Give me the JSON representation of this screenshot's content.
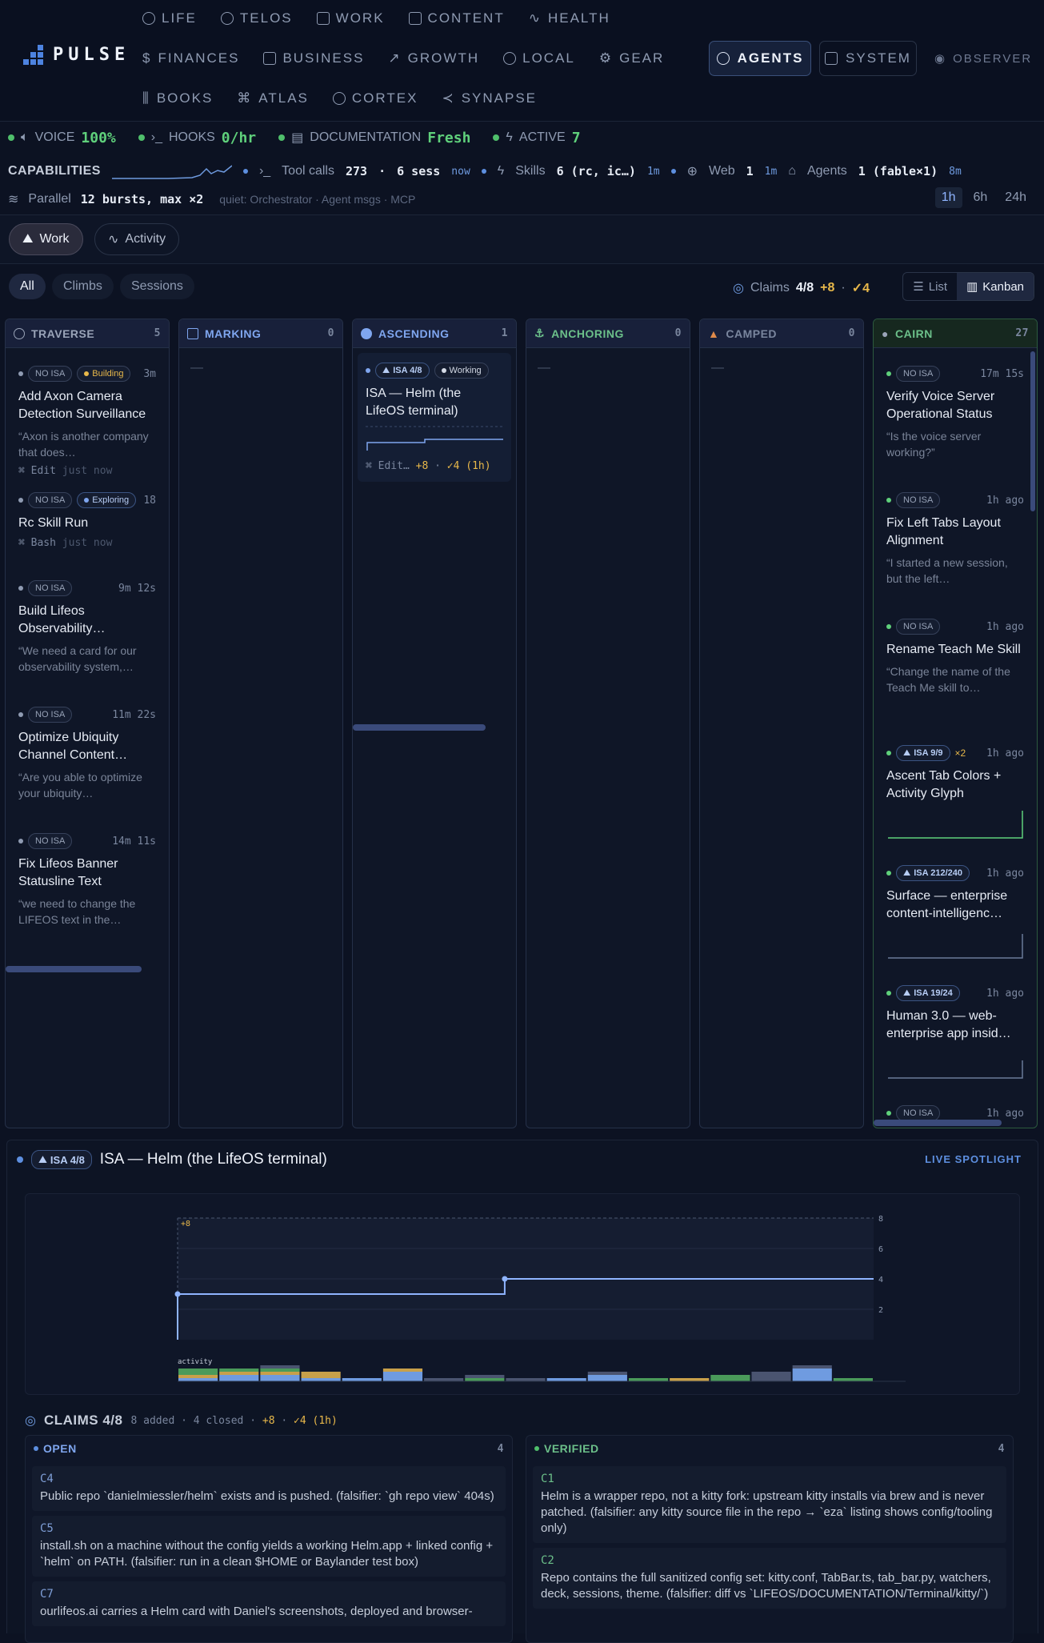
{
  "app": {
    "name": "PULSE"
  },
  "nav": {
    "row1": [
      {
        "label": "LIFE",
        "icon": "compass-icon"
      },
      {
        "label": "TELOS",
        "icon": "target-icon"
      },
      {
        "label": "WORK",
        "icon": "folder-icon"
      },
      {
        "label": "CONTENT",
        "icon": "file-stack-icon"
      },
      {
        "label": "HEALTH",
        "icon": "pulse-icon"
      }
    ],
    "row2": [
      {
        "label": "FINANCES",
        "icon": "dollar-icon"
      },
      {
        "label": "BUSINESS",
        "icon": "building-icon"
      },
      {
        "label": "GROWTH",
        "icon": "trend-up-icon"
      },
      {
        "label": "LOCAL",
        "icon": "map-pin-icon"
      },
      {
        "label": "GEAR",
        "icon": "gear-icon"
      }
    ],
    "row3": [
      {
        "label": "BOOKS",
        "icon": "books-icon"
      },
      {
        "label": "ATLAS",
        "icon": "network-icon"
      },
      {
        "label": "CORTEX",
        "icon": "brain-icon"
      },
      {
        "label": "SYNAPSE",
        "icon": "share-icon"
      }
    ],
    "agents": "AGENTS",
    "system": "SYSTEM",
    "observer": "OBSERVER"
  },
  "status": {
    "voice_label": "VOICE",
    "voice_value": "100%",
    "hooks_label": "HOOKS",
    "hooks_value": "0/hr",
    "docs_label": "DOCUMENTATION",
    "docs_value": "Fresh",
    "active_label": "ACTIVE",
    "active_value": "7"
  },
  "capabilities": {
    "label": "CAPABILITIES",
    "tool_calls_label": "Tool calls",
    "tool_calls_value": "273",
    "sep": "·",
    "sess_value": "6 sess",
    "tool_calls_time": "now",
    "skills_label": "Skills",
    "skills_value": "6 (rc, ic…)",
    "skills_time": "1m",
    "web_label": "Web",
    "web_value": "1",
    "web_time": "1m",
    "agents_label": "Agents",
    "agents_value": "1 (fable×1)",
    "agents_time": "8m"
  },
  "parallel": {
    "label": "Parallel",
    "value": "12 bursts, max ×2",
    "quiet": "quiet: Orchestrator · Agent msgs · MCP"
  },
  "time_range": {
    "options": [
      "1h",
      "6h",
      "24h"
    ],
    "selected": "1h"
  },
  "view_tabs": {
    "work": "Work",
    "activity": "Activity"
  },
  "filters": {
    "all": "All",
    "climbs": "Climbs",
    "sessions": "Sessions"
  },
  "claims_summary": {
    "label": "Claims",
    "value": "4/8",
    "added": "+8",
    "sep": "·",
    "closed": "✓4"
  },
  "view_switch": {
    "list": "List",
    "kanban": "Kanban"
  },
  "columns": [
    {
      "name": "TRAVERSE",
      "count": "5",
      "color": "#9aa4b8"
    },
    {
      "name": "MARKING",
      "count": "0",
      "color": "#7fa6ef"
    },
    {
      "name": "ASCENDING",
      "count": "1",
      "color": "#7fa6ef"
    },
    {
      "name": "ANCHORING",
      "count": "0",
      "color": "#6cc08a"
    },
    {
      "name": "CAMPED",
      "count": "0",
      "color": "#7a869e"
    },
    {
      "name": "CAIRN",
      "count": "27",
      "color": "#6cc08a"
    }
  ],
  "empty_mark": "—",
  "traverse_cards": [
    {
      "badge": "NO ISA",
      "state": "Building",
      "age": "3m",
      "title": "Add Axon Camera Detection Surveillance",
      "quote": "“Axon is another company that does…",
      "tool": "⌘ Edit",
      "tool_time": "just now"
    },
    {
      "badge": "NO ISA",
      "state": "Exploring",
      "age": "18",
      "title": "Rc Skill Run",
      "quote": "",
      "tool": "⌘ Bash",
      "tool_time": "just now"
    },
    {
      "badge": "NO ISA",
      "state": "",
      "age": "9m 12s",
      "title": "Build Lifeos Observability…",
      "quote": "“We need a card for our observability system,…",
      "tool": "",
      "tool_time": ""
    },
    {
      "badge": "NO ISA",
      "state": "",
      "age": "11m 22s",
      "title": "Optimize Ubiquity Channel Content…",
      "quote": "“Are you able to optimize your ubiquity…",
      "tool": "",
      "tool_time": ""
    },
    {
      "badge": "NO ISA",
      "state": "",
      "age": "14m 11s",
      "title": "Fix Lifeos Banner Statusline Text",
      "quote": "“we need to change the LIFEOS text in the…",
      "tool": "",
      "tool_time": ""
    }
  ],
  "ascending_card": {
    "badge": "ISA 4/8",
    "state": "Working",
    "title": "ISA — Helm (the LifeOS terminal)",
    "tool": "⌘ Edit…",
    "added": "+8",
    "closed": "✓4 (1h)"
  },
  "cairn_cards": [
    {
      "badge": "NO ISA",
      "extra": "",
      "age": "17m 15s",
      "title": "Verify Voice Server Operational Status",
      "quote": "“Is the voice server working?”"
    },
    {
      "badge": "NO ISA",
      "extra": "",
      "age": "1h ago",
      "title": "Fix Left Tabs Layout Alignment",
      "quote": "“I started a new session, but the left…"
    },
    {
      "badge": "NO ISA",
      "extra": "",
      "age": "1h ago",
      "title": "Rename Teach Me Skill",
      "quote": "“Change the name of the Teach Me skill to…"
    },
    {
      "badge": "ISA 9/9",
      "extra": "×2",
      "age": "1h ago",
      "title": "Ascent Tab Colors + Activity Glyph",
      "quote": ""
    },
    {
      "badge": "ISA 212/240",
      "extra": "",
      "age": "1h ago",
      "title": "Surface — enterprise content-intelligenc…",
      "quote": ""
    },
    {
      "badge": "ISA 19/24",
      "extra": "",
      "age": "1h ago",
      "title": "Human 3.0 — web-enterprise app insid…",
      "quote": ""
    },
    {
      "badge": "NO ISA",
      "extra": "",
      "age": "1h ago",
      "title": "",
      "quote": ""
    }
  ],
  "spotlight": {
    "badge": "ISA 4/8",
    "title": "ISA — Helm (the LifeOS terminal)",
    "live": "LIVE SPOTLIGHT"
  },
  "chart_data": {
    "type": "line",
    "title": "",
    "xlabel": "",
    "ylabel": "",
    "ylim": [
      0,
      8
    ],
    "yticks": [
      2,
      4,
      6,
      8
    ],
    "series": [
      {
        "name": "",
        "step": true,
        "x": [
          0,
          0.47,
          1
        ],
        "values": [
          3,
          4,
          4
        ]
      }
    ],
    "annotation": "+8",
    "activity_label": "activity",
    "activity": [
      [
        1,
        1,
        2,
        0
      ],
      [
        2,
        1,
        1,
        0
      ],
      [
        2,
        1,
        1,
        1
      ],
      [
        1,
        2,
        0,
        0
      ],
      [
        1,
        0,
        0,
        0
      ],
      [
        3,
        1,
        0,
        0
      ],
      [
        0,
        0,
        0,
        1
      ],
      [
        0,
        0,
        1,
        1
      ],
      [
        0,
        0,
        0,
        1
      ],
      [
        1,
        0,
        0,
        0
      ],
      [
        2,
        0,
        0,
        1
      ],
      [
        0,
        0,
        1,
        0
      ],
      [
        0,
        1,
        0,
        0
      ],
      [
        0,
        0,
        2,
        0
      ],
      [
        0,
        0,
        0,
        3
      ],
      [
        4,
        0,
        0,
        1
      ],
      [
        0,
        0,
        1,
        0
      ]
    ]
  },
  "claims": {
    "title": "CLAIMS 4/8",
    "meta": "8 added · 4 closed",
    "added": "+8",
    "closed": "✓4 (1h)",
    "open_label": "OPEN",
    "open_count": "4",
    "verified_label": "VERIFIED",
    "verified_count": "4",
    "open": [
      {
        "id": "C4",
        "text": "Public repo `danielmiessler/helm` exists and is pushed. (falsifier: `gh repo view` 404s)"
      },
      {
        "id": "C5",
        "text": "install.sh on a machine without the config yields a working Helm.app + linked config + `helm` on PATH. (falsifier: run in a clean $HOME or Baylander test box)"
      },
      {
        "id": "C7",
        "text": "ourlifeos.ai carries a Helm card with Daniel's screenshots, deployed and browser-"
      }
    ],
    "verified": [
      {
        "id": "C1",
        "text": "Helm is a wrapper repo, not a kitty fork: upstream kitty installs via brew and is never patched. (falsifier: any kitty source file in the repo → `eza` listing shows config/tooling only)"
      },
      {
        "id": "C2",
        "text": "Repo contains the full sanitized config set: kitty.conf, TabBar.ts, tab_bar.py, watchers, deck, sessions, theme. (falsifier: diff vs `LIFEOS/DOCUMENTATION/Terminal/kitty/`)"
      }
    ]
  },
  "colors": {
    "accent": "#5d8fe0",
    "green": "#5fd07b",
    "amber": "#e8b84a",
    "bg": "#0c1222"
  }
}
